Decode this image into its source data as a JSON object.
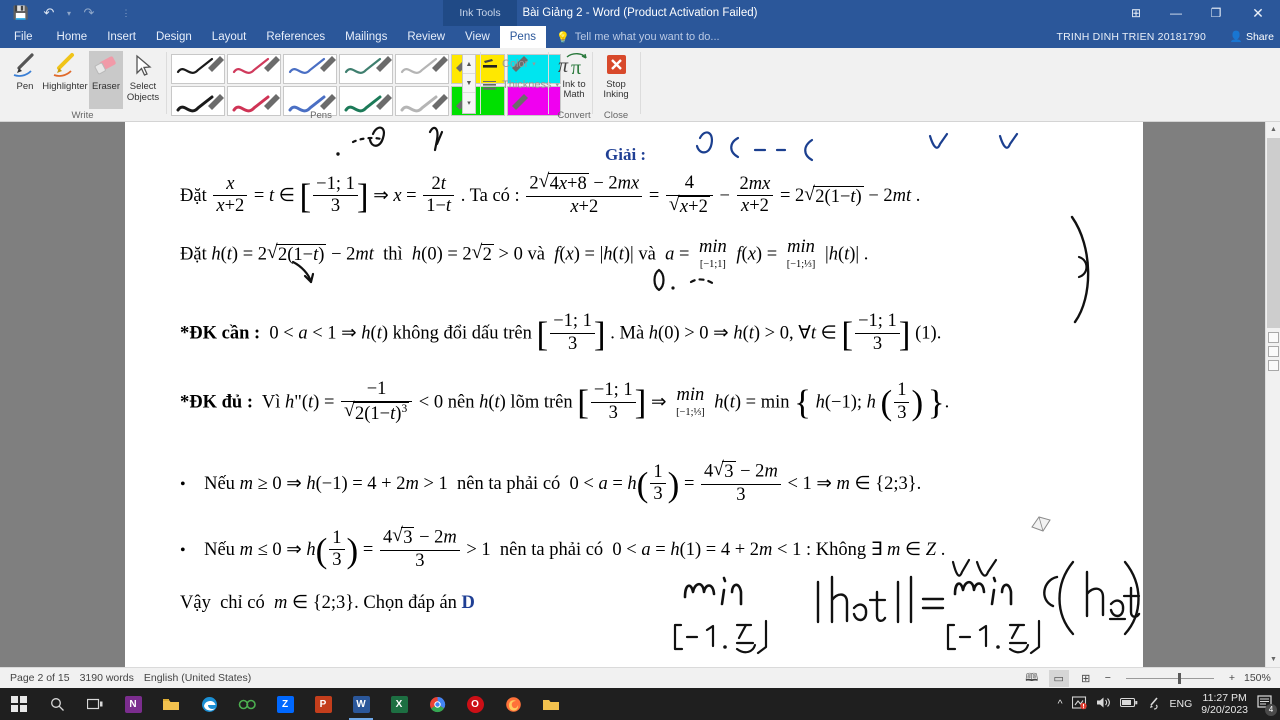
{
  "window": {
    "title": "Bài Giảng 2 - Word (Product Activation Failed)",
    "contextual_tool_label": "Ink Tools",
    "quick_access": [
      "save-icon",
      "undo-icon",
      "redo-icon",
      "customize-icon"
    ],
    "controls": [
      "ribbon-display-icon",
      "minimize-icon",
      "restore-icon",
      "close-icon"
    ]
  },
  "tabs": [
    {
      "label": "File",
      "active": false
    },
    {
      "label": "Home",
      "active": false
    },
    {
      "label": "Insert",
      "active": false
    },
    {
      "label": "Design",
      "active": false
    },
    {
      "label": "Layout",
      "active": false
    },
    {
      "label": "References",
      "active": false
    },
    {
      "label": "Mailings",
      "active": false
    },
    {
      "label": "Review",
      "active": false
    },
    {
      "label": "View",
      "active": false
    },
    {
      "label": "Pens",
      "active": true
    }
  ],
  "tellme": "Tell me what you want to do...",
  "account": {
    "user": "TRINH DINH TRIEN 20181790",
    "share_label": "Share"
  },
  "ribbon": {
    "groups": [
      {
        "name": "Write",
        "label": "Write"
      },
      {
        "name": "Pens",
        "label": "Pens"
      },
      {
        "name": "Convert",
        "label": "Convert"
      },
      {
        "name": "Close",
        "label": "Close"
      }
    ],
    "write_buttons": [
      {
        "label": "Pen",
        "selected": false
      },
      {
        "label": "Highlighter",
        "selected": false
      },
      {
        "label": "Eraser",
        "selected": true
      },
      {
        "label": "Select Objects",
        "selected": false
      }
    ],
    "pen_colors_row1": [
      "#1a1a1a",
      "#d03a5c",
      "#4a6fc4",
      "#3f7f6f",
      "#9a9a9a",
      "#ffe800",
      "#00e5ef"
    ],
    "pen_colors_row2": [
      "#1a1a1a",
      "#cf3355",
      "#4a6fc4",
      "#1c7a58",
      "#9a9a9a",
      "#00e000",
      "#f000f0"
    ],
    "color_label": "Color",
    "thickness_label": "Thickness",
    "ink_to_math_label": "Ink to Math",
    "stop_inking_label": "Stop Inking"
  },
  "document": {
    "heading": "Giải :",
    "lines": [
      {
        "id": "l1",
        "text": "Đặt x/(x+2) = t ∈ [−1; 1/3] ⇒ x = 2t/(1−t). Ta có : (2√(4x+8) − 2mx)/(x+2) = 4/√(x+2) − 2mx/(x+2) = 2√(2(1−t)) − 2mt ."
      },
      {
        "id": "l2",
        "text": "Đặt h(t) = 2√(2(1−t)) − 2mt thì h(0) = 2√2 > 0 và f(x) = |h(t)| và a = min[−1;1] f(x) = min[−1;1/3] |h(t)| ."
      },
      {
        "id": "l3",
        "text": "*ĐK cần : 0 < a < 1 ⇒ h(t) không đổi dấu trên [−1; 1/3]. Mà h(0) > 0 ⇒ h(t) > 0, ∀t ∈ [−1; 1/3] (1)."
      },
      {
        "id": "l4",
        "text": "*ĐK đủ : Vì h\"(t) = −1/√(2(1−t)³) < 0 nên h(t) lõm trên [−1; 1/3] ⇒ min[−1;1/3] h(t) = min{ h(−1); h(1/3) }."
      },
      {
        "id": "l5",
        "text": "• Nếu m ≥ 0 ⇒ h(−1) = 4 + 2m > 1 nên ta phải có 0 < a = h(1/3) = (4√3 − 2m)/3 < 1 ⇒ m ∈ {2;3}."
      },
      {
        "id": "l6",
        "text": "• Nếu m ≤ 0 ⇒ h(1/3) = (4√3 − 2m)/3 > 1 nên ta phải có 0 < a = h(1) = 4 + 2m < 1 : Không ∃ m ∈ Z ."
      },
      {
        "id": "l7",
        "text": "Vậy chỉ có m ∈ {2;3}. Chọn đáp án D."
      }
    ],
    "answer_letter": "D"
  },
  "status": {
    "page": "Page 2 of 15",
    "words": "3190 words",
    "language": "English (United States)",
    "zoom": "150%",
    "view_buttons": [
      "read-mode-icon",
      "print-layout-icon",
      "web-layout-icon"
    ],
    "zoom_out": "−",
    "zoom_in": "+"
  },
  "taskbar": {
    "start": "windows-start-icon",
    "search": "search-icon",
    "apps": [
      {
        "name": "task-view-icon",
        "glyph": "❐",
        "color": "#d9d9d9",
        "bg": "transparent"
      },
      {
        "name": "onenote-icon",
        "glyph": "N",
        "color": "#ffffff",
        "bg": "#7b2d8e"
      },
      {
        "name": "file-explorer-icon",
        "glyph": "▤",
        "color": "#ffc83d",
        "bg": "transparent"
      },
      {
        "name": "edge-icon",
        "glyph": "e",
        "color": "#3fa9f5",
        "bg": "transparent"
      },
      {
        "name": "unikey-icon",
        "glyph": "∞",
        "color": "#4caf50",
        "bg": "transparent"
      },
      {
        "name": "zalo-icon",
        "glyph": "Z",
        "color": "#ffffff",
        "bg": "#0068ff"
      },
      {
        "name": "powerpoint-icon",
        "glyph": "P",
        "color": "#ffffff",
        "bg": "#c43e1c"
      },
      {
        "name": "word-icon",
        "glyph": "W",
        "color": "#ffffff",
        "bg": "#2b579a"
      },
      {
        "name": "excel-icon",
        "glyph": "X",
        "color": "#ffffff",
        "bg": "#1d6f42"
      },
      {
        "name": "chrome-icon",
        "glyph": "◉",
        "color": "#4285f4",
        "bg": "transparent"
      },
      {
        "name": "opera-icon",
        "glyph": "O",
        "color": "#ffffff",
        "bg": "#cc0f16"
      },
      {
        "name": "firefox-icon",
        "glyph": "◓",
        "color": "#ff7139",
        "bg": "transparent"
      },
      {
        "name": "folder-icon",
        "glyph": "▰",
        "color": "#f2c14e",
        "bg": "transparent"
      }
    ],
    "tray": {
      "chevron": "show-hidden-icons",
      "security": "security-alert-icon",
      "volume": "volume-icon",
      "battery": "battery-icon",
      "pen": "pen-icon",
      "language": "ENG",
      "time": "11:27 PM",
      "date": "9/20/2023",
      "notifications": "4"
    }
  },
  "colors": {
    "word_blue": "#2b579a",
    "doc_gray": "#7f7f7f",
    "accent_blue": "#1f3f94"
  }
}
